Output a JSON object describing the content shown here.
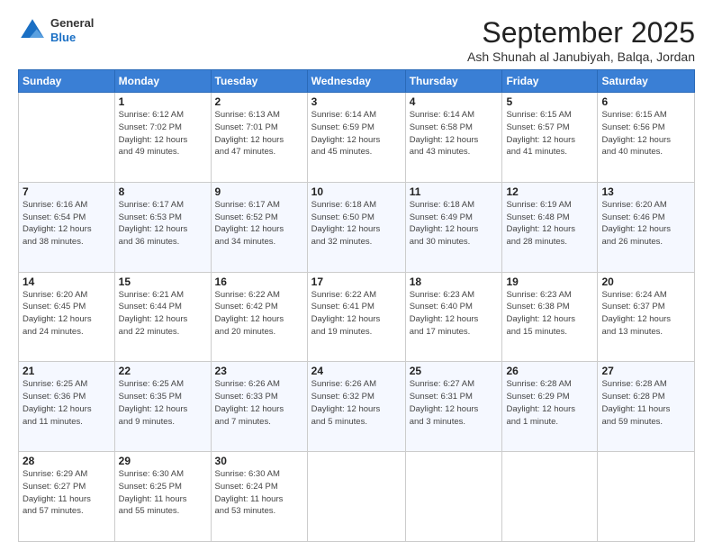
{
  "header": {
    "logo": {
      "general": "General",
      "blue": "Blue"
    },
    "title": "September 2025",
    "subtitle": "Ash Shunah al Janubiyah, Balqa, Jordan"
  },
  "calendar": {
    "days": [
      "Sunday",
      "Monday",
      "Tuesday",
      "Wednesday",
      "Thursday",
      "Friday",
      "Saturday"
    ],
    "weeks": [
      [
        {
          "day": "",
          "info": ""
        },
        {
          "day": "1",
          "info": "Sunrise: 6:12 AM\nSunset: 7:02 PM\nDaylight: 12 hours\nand 49 minutes."
        },
        {
          "day": "2",
          "info": "Sunrise: 6:13 AM\nSunset: 7:01 PM\nDaylight: 12 hours\nand 47 minutes."
        },
        {
          "day": "3",
          "info": "Sunrise: 6:14 AM\nSunset: 6:59 PM\nDaylight: 12 hours\nand 45 minutes."
        },
        {
          "day": "4",
          "info": "Sunrise: 6:14 AM\nSunset: 6:58 PM\nDaylight: 12 hours\nand 43 minutes."
        },
        {
          "day": "5",
          "info": "Sunrise: 6:15 AM\nSunset: 6:57 PM\nDaylight: 12 hours\nand 41 minutes."
        },
        {
          "day": "6",
          "info": "Sunrise: 6:15 AM\nSunset: 6:56 PM\nDaylight: 12 hours\nand 40 minutes."
        }
      ],
      [
        {
          "day": "7",
          "info": "Sunrise: 6:16 AM\nSunset: 6:54 PM\nDaylight: 12 hours\nand 38 minutes."
        },
        {
          "day": "8",
          "info": "Sunrise: 6:17 AM\nSunset: 6:53 PM\nDaylight: 12 hours\nand 36 minutes."
        },
        {
          "day": "9",
          "info": "Sunrise: 6:17 AM\nSunset: 6:52 PM\nDaylight: 12 hours\nand 34 minutes."
        },
        {
          "day": "10",
          "info": "Sunrise: 6:18 AM\nSunset: 6:50 PM\nDaylight: 12 hours\nand 32 minutes."
        },
        {
          "day": "11",
          "info": "Sunrise: 6:18 AM\nSunset: 6:49 PM\nDaylight: 12 hours\nand 30 minutes."
        },
        {
          "day": "12",
          "info": "Sunrise: 6:19 AM\nSunset: 6:48 PM\nDaylight: 12 hours\nand 28 minutes."
        },
        {
          "day": "13",
          "info": "Sunrise: 6:20 AM\nSunset: 6:46 PM\nDaylight: 12 hours\nand 26 minutes."
        }
      ],
      [
        {
          "day": "14",
          "info": "Sunrise: 6:20 AM\nSunset: 6:45 PM\nDaylight: 12 hours\nand 24 minutes."
        },
        {
          "day": "15",
          "info": "Sunrise: 6:21 AM\nSunset: 6:44 PM\nDaylight: 12 hours\nand 22 minutes."
        },
        {
          "day": "16",
          "info": "Sunrise: 6:22 AM\nSunset: 6:42 PM\nDaylight: 12 hours\nand 20 minutes."
        },
        {
          "day": "17",
          "info": "Sunrise: 6:22 AM\nSunset: 6:41 PM\nDaylight: 12 hours\nand 19 minutes."
        },
        {
          "day": "18",
          "info": "Sunrise: 6:23 AM\nSunset: 6:40 PM\nDaylight: 12 hours\nand 17 minutes."
        },
        {
          "day": "19",
          "info": "Sunrise: 6:23 AM\nSunset: 6:38 PM\nDaylight: 12 hours\nand 15 minutes."
        },
        {
          "day": "20",
          "info": "Sunrise: 6:24 AM\nSunset: 6:37 PM\nDaylight: 12 hours\nand 13 minutes."
        }
      ],
      [
        {
          "day": "21",
          "info": "Sunrise: 6:25 AM\nSunset: 6:36 PM\nDaylight: 12 hours\nand 11 minutes."
        },
        {
          "day": "22",
          "info": "Sunrise: 6:25 AM\nSunset: 6:35 PM\nDaylight: 12 hours\nand 9 minutes."
        },
        {
          "day": "23",
          "info": "Sunrise: 6:26 AM\nSunset: 6:33 PM\nDaylight: 12 hours\nand 7 minutes."
        },
        {
          "day": "24",
          "info": "Sunrise: 6:26 AM\nSunset: 6:32 PM\nDaylight: 12 hours\nand 5 minutes."
        },
        {
          "day": "25",
          "info": "Sunrise: 6:27 AM\nSunset: 6:31 PM\nDaylight: 12 hours\nand 3 minutes."
        },
        {
          "day": "26",
          "info": "Sunrise: 6:28 AM\nSunset: 6:29 PM\nDaylight: 12 hours\nand 1 minute."
        },
        {
          "day": "27",
          "info": "Sunrise: 6:28 AM\nSunset: 6:28 PM\nDaylight: 11 hours\nand 59 minutes."
        }
      ],
      [
        {
          "day": "28",
          "info": "Sunrise: 6:29 AM\nSunset: 6:27 PM\nDaylight: 11 hours\nand 57 minutes."
        },
        {
          "day": "29",
          "info": "Sunrise: 6:30 AM\nSunset: 6:25 PM\nDaylight: 11 hours\nand 55 minutes."
        },
        {
          "day": "30",
          "info": "Sunrise: 6:30 AM\nSunset: 6:24 PM\nDaylight: 11 hours\nand 53 minutes."
        },
        {
          "day": "",
          "info": ""
        },
        {
          "day": "",
          "info": ""
        },
        {
          "day": "",
          "info": ""
        },
        {
          "day": "",
          "info": ""
        }
      ]
    ]
  }
}
